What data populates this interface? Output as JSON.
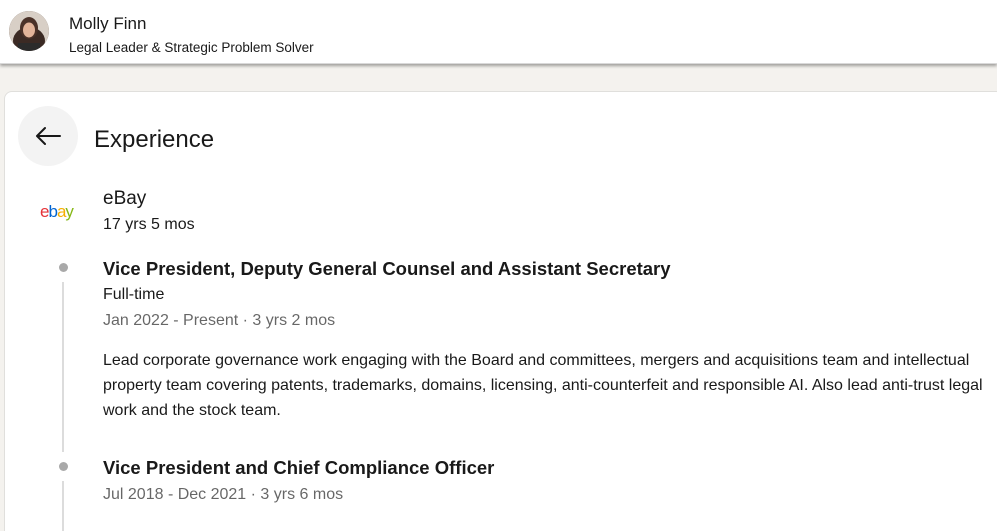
{
  "profile": {
    "name": "Molly Finn",
    "headline": "Legal Leader & Strategic Problem Solver"
  },
  "section": {
    "title": "Experience"
  },
  "company": {
    "name": "eBay",
    "logo_text": "ebay",
    "duration": "17 yrs 5 mos",
    "logo_colors": [
      "#e53238",
      "#0064d2",
      "#f5af02",
      "#86b817"
    ]
  },
  "roles": [
    {
      "title": "Vice President, Deputy General Counsel and Assistant Secretary",
      "employment_type": "Full-time",
      "dates": "Jan 2022 - Present · 3 yrs 2 mos",
      "description": "Lead corporate governance work engaging with the Board and committees, mergers and acquisitions team and intellectual property team covering patents, trademarks, domains, licensing, anti-counterfeit and responsible AI. Also lead anti-trust legal work and the stock team."
    },
    {
      "title": "Vice President and Chief Compliance Officer",
      "dates": "Jul 2018 - Dec 2021 · 3 yrs 6 mos"
    }
  ],
  "icons": {
    "back": "arrow-left-icon"
  }
}
